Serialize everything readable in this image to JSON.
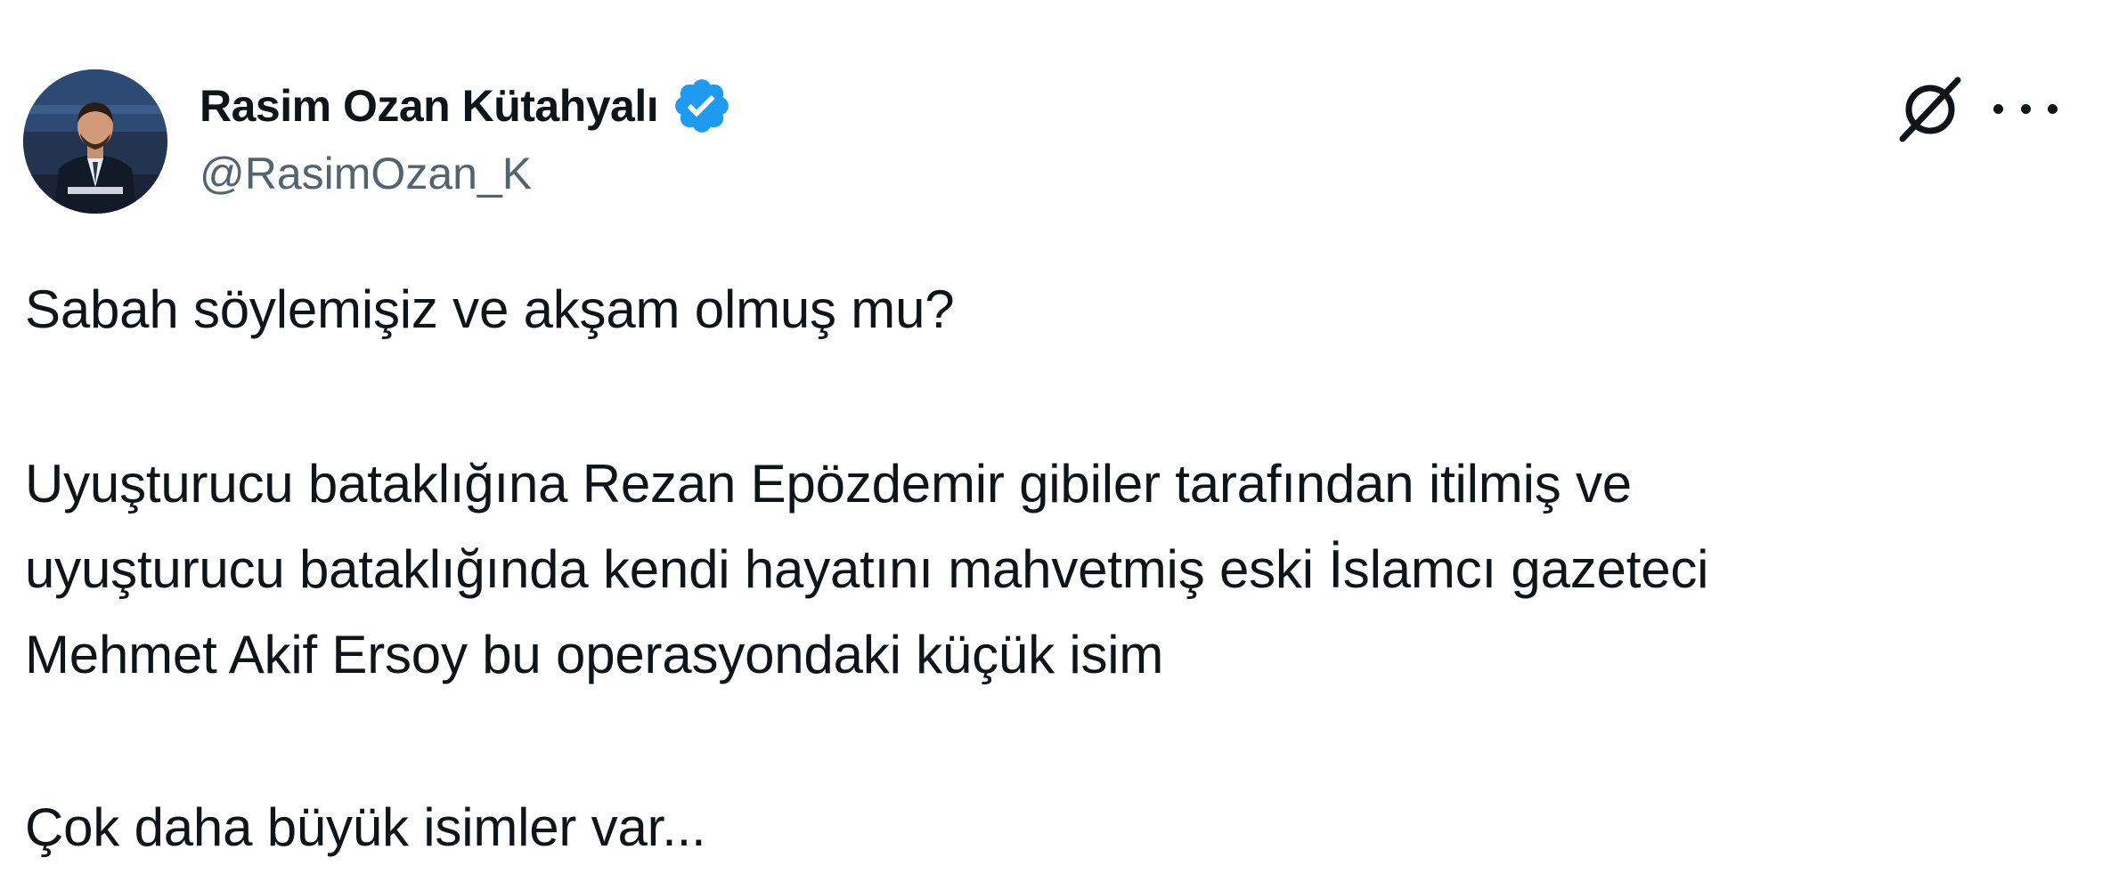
{
  "author": {
    "display_name": "Rasim Ozan Kütahyalı",
    "handle": "@RasimOzan_K",
    "verified_icon": "verified-badge-icon",
    "verified_color": "#1d9bf0"
  },
  "actions": {
    "grok_icon": "grok-icon",
    "more_icon": "more-options-icon"
  },
  "tweet": {
    "paragraph1": "Sabah söylemişiz ve akşam olmuş mu?",
    "paragraph2_lines": [
      "Uyuşturucu bataklığına Rezan Epözdemir gibiler tarafından itilmiş ve",
      "uyuşturucu bataklığında kendi hayatını mahvetmiş eski İslamcı gazeteci",
      "Mehmet Akif Ersoy bu operasyondaki küçük isim"
    ],
    "paragraph3": "Çok daha büyük isimler var..."
  },
  "colors": {
    "text": "#0f1419",
    "secondary_text": "#536471",
    "background": "#ffffff"
  }
}
